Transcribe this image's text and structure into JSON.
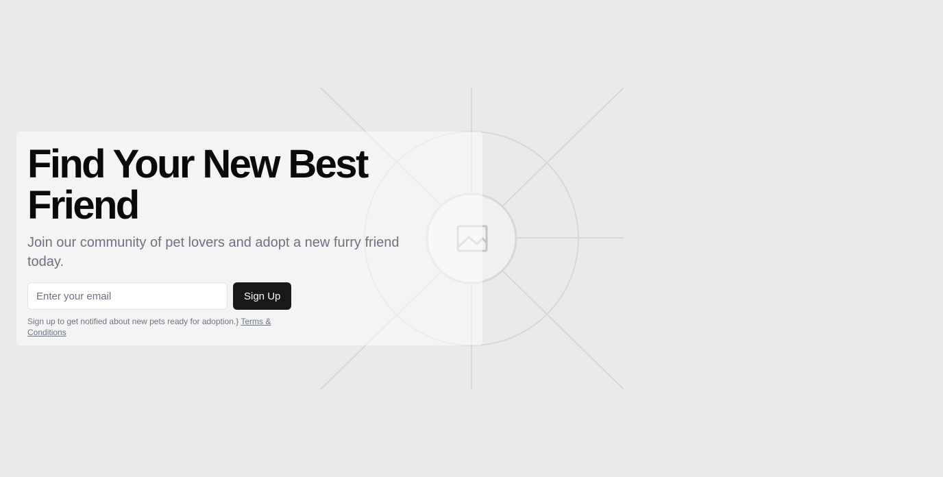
{
  "hero": {
    "title": "Find Your New Best Friend",
    "subtitle": "Join our community of pet lovers and adopt a new furry friend today.",
    "email_placeholder": "Enter your email",
    "signup_label": "Sign Up",
    "fineprint_text": "Sign up to get notified about new pets ready for adoption.}",
    "terms_label": "Terms & Conditions"
  },
  "image": {
    "icon": "image-placeholder-icon"
  },
  "colors": {
    "background": "#e9e9e9",
    "button": "#18181b",
    "muted_text": "#6b7280"
  }
}
